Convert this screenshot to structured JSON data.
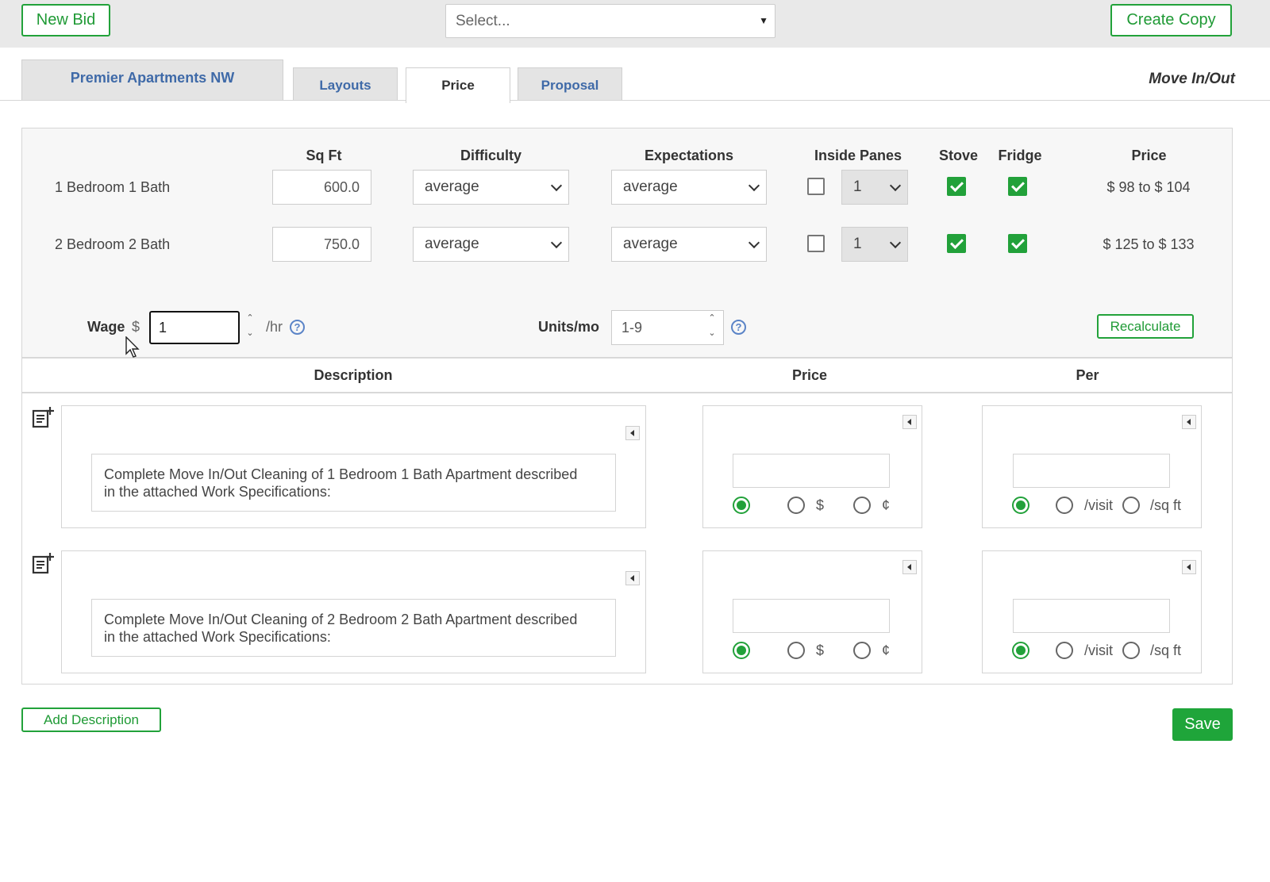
{
  "topbar": {
    "new_bid_label": "New Bid",
    "select_value": "Select...",
    "create_copy_label": "Create Copy"
  },
  "tabs": {
    "property": "Premier Apartments NW",
    "layouts": "Layouts",
    "price": "Price",
    "proposal": "Proposal",
    "service": "Move In/Out"
  },
  "table": {
    "headers": {
      "sqft": "Sq Ft",
      "difficulty": "Difficulty",
      "expectations": "Expectations",
      "inside_panes": "Inside Panes",
      "stove": "Stove",
      "fridge": "Fridge",
      "price": "Price"
    },
    "rows": [
      {
        "name": "1 Bedroom 1 Bath",
        "sqft": "600.0",
        "difficulty": "average",
        "expectations": "average",
        "inside_panes_checked": false,
        "panes": "1",
        "stove": true,
        "fridge": true,
        "price": "$ 98 to $ 104"
      },
      {
        "name": "2 Bedroom 2 Bath",
        "sqft": "750.0",
        "difficulty": "average",
        "expectations": "average",
        "inside_panes_checked": false,
        "panes": "1",
        "stove": true,
        "fridge": true,
        "price": "$ 125 to $ 133"
      }
    ]
  },
  "wage": {
    "label": "Wage",
    "currency": "$",
    "value": "1",
    "unit": "/hr"
  },
  "units": {
    "label": "Units/mo",
    "value": "1-9"
  },
  "recalculate_label": "Recalculate",
  "lines_headers": {
    "description": "Description",
    "price": "Price",
    "per": "Per"
  },
  "lines": [
    {
      "description": "Complete Move In/Out Cleaning of 1 Bedroom 1 Bath Apartment described in the attached Work Specifications:"
    },
    {
      "description": "Complete Move In/Out Cleaning of 2 Bedroom 2 Bath Apartment described in the attached Work Specifications:"
    }
  ],
  "price_options": {
    "dollar": "$",
    "cent": "¢"
  },
  "per_options": {
    "visit": "/visit",
    "sqft": "/sq ft"
  },
  "add_description_label": "Add Description",
  "save_label": "Save",
  "colors": {
    "accent": "#22a13a",
    "link": "#3f6aa8"
  }
}
